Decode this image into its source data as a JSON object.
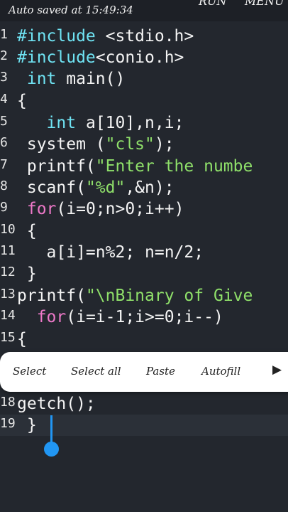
{
  "status": {
    "autosave": "Auto saved at 15:49:34",
    "run_label": "RUN",
    "menu_label": "MENU"
  },
  "code": {
    "lines": [
      {
        "n": "1",
        "parts": [
          {
            "t": "#include",
            "c": "kw"
          },
          {
            "t": " <stdio.h>",
            "c": ""
          }
        ]
      },
      {
        "n": "2",
        "parts": [
          {
            "t": "#include",
            "c": "kw"
          },
          {
            "t": "<conio.h>",
            "c": ""
          }
        ]
      },
      {
        "n": "3",
        "parts": [
          {
            "t": " ",
            "c": ""
          },
          {
            "t": "int",
            "c": "kw"
          },
          {
            "t": " main()",
            "c": ""
          }
        ]
      },
      {
        "n": "4",
        "parts": [
          {
            "t": "{",
            "c": ""
          }
        ]
      },
      {
        "n": "5",
        "parts": [
          {
            "t": "   ",
            "c": ""
          },
          {
            "t": "int",
            "c": "kw"
          },
          {
            "t": " a[10],n,i;",
            "c": ""
          }
        ]
      },
      {
        "n": "6",
        "parts": [
          {
            "t": " system (",
            "c": ""
          },
          {
            "t": "\"cls\"",
            "c": "str"
          },
          {
            "t": ");",
            "c": ""
          }
        ]
      },
      {
        "n": "7",
        "parts": [
          {
            "t": " printf(",
            "c": ""
          },
          {
            "t": "\"Enter the numbe",
            "c": "str"
          }
        ]
      },
      {
        "n": "8",
        "parts": [
          {
            "t": " scanf(",
            "c": ""
          },
          {
            "t": "\"%d\"",
            "c": "str"
          },
          {
            "t": ",&n);",
            "c": ""
          }
        ]
      },
      {
        "n": "9",
        "parts": [
          {
            "t": " ",
            "c": ""
          },
          {
            "t": "for",
            "c": "ctl"
          },
          {
            "t": "(i=0;n>0;i++)",
            "c": ""
          }
        ]
      },
      {
        "n": "10",
        "parts": [
          {
            "t": " {",
            "c": ""
          }
        ]
      },
      {
        "n": "11",
        "parts": [
          {
            "t": "   a[i]=n%2; n=n/2;",
            "c": ""
          }
        ]
      },
      {
        "n": "12",
        "parts": [
          {
            "t": " }",
            "c": ""
          }
        ]
      },
      {
        "n": "13",
        "parts": [
          {
            "t": "printf(",
            "c": ""
          },
          {
            "t": "\"\\nBinary of Give",
            "c": "str"
          }
        ]
      },
      {
        "n": "14",
        "parts": [
          {
            "t": "  ",
            "c": ""
          },
          {
            "t": "for",
            "c": "ctl"
          },
          {
            "t": "(i=i-1;i>=0;i--)",
            "c": ""
          }
        ]
      },
      {
        "n": "15",
        "parts": [
          {
            "t": "{",
            "c": ""
          }
        ]
      },
      {
        "n": "18",
        "parts": [
          {
            "t": "getch();",
            "c": ""
          }
        ]
      },
      {
        "n": "19",
        "parts": [
          {
            "t": " }",
            "c": ""
          }
        ]
      }
    ]
  },
  "context_menu": {
    "select": "Select",
    "select_all": "Select all",
    "paste": "Paste",
    "autofill": "Autofill",
    "more_icon": "play-triangle-icon",
    "more_glyph": "▶"
  },
  "colors": {
    "background": "#23272e",
    "keyword": "#6fe3f3",
    "control": "#ee79c9",
    "string": "#8fe06a",
    "cursor": "#2196f3"
  }
}
